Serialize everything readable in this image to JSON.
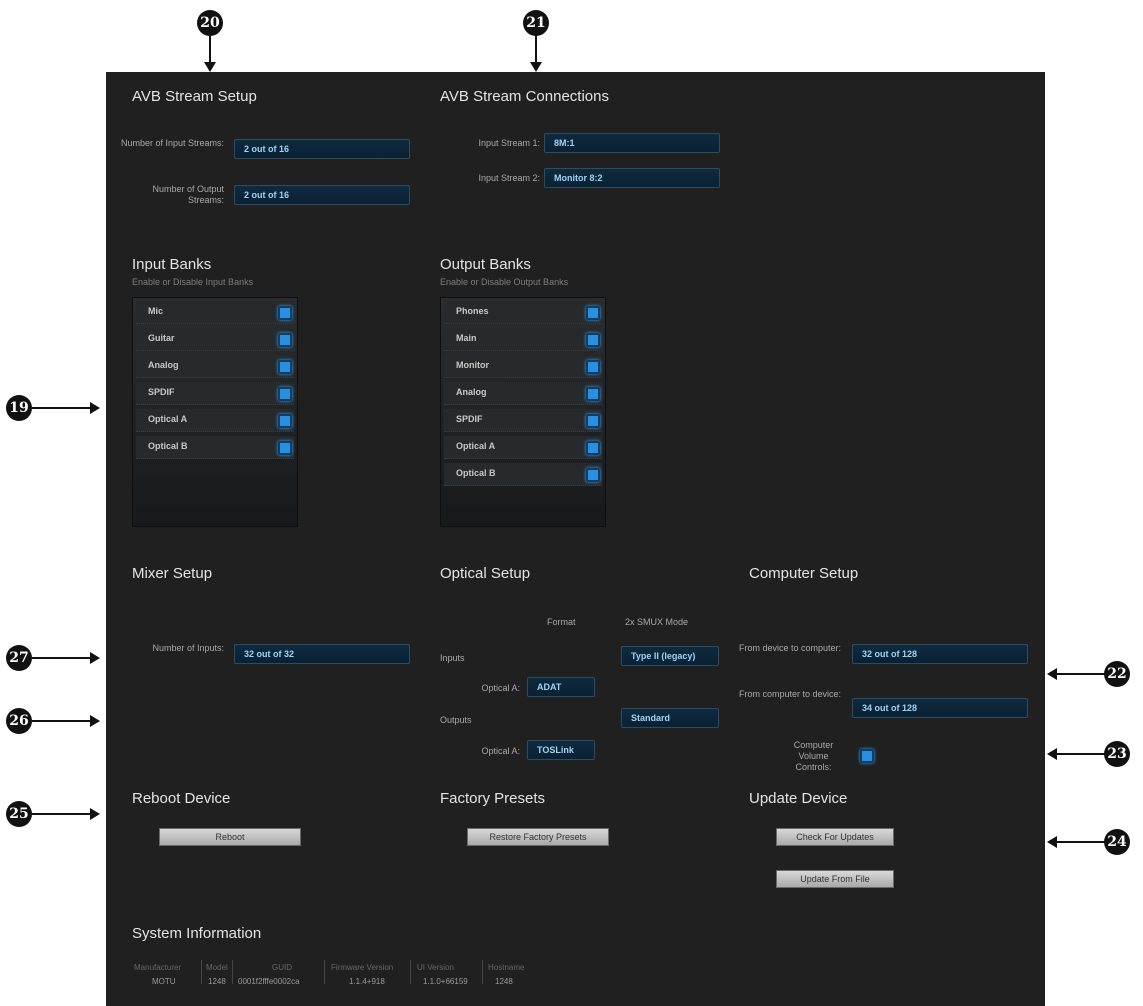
{
  "callouts": {
    "c19": "19",
    "c20": "20",
    "c21": "21",
    "c22": "22",
    "c23": "23",
    "c24": "24",
    "c25": "25",
    "c26": "26",
    "c27": "27"
  },
  "avb_setup": {
    "title": "AVB Stream Setup",
    "input_label": "Number of Input Streams:",
    "input_value": "2 out of 16",
    "output_label": "Number of Output Streams:",
    "output_value": "2 out of 16"
  },
  "avb_connections": {
    "title": "AVB Stream Connections",
    "stream1_label": "Input Stream 1:",
    "stream1_value": "8M:1",
    "stream2_label": "Input Stream 2:",
    "stream2_value": "Monitor 8:2"
  },
  "input_banks": {
    "title": "Input Banks",
    "subtitle": "Enable or Disable Input Banks",
    "items": [
      "Mic",
      "Guitar",
      "Analog",
      "SPDIF",
      "Optical A",
      "Optical B"
    ]
  },
  "output_banks": {
    "title": "Output Banks",
    "subtitle": "Enable or Disable Output Banks",
    "items": [
      "Phones",
      "Main",
      "Monitor",
      "Analog",
      "SPDIF",
      "Optical A",
      "Optical B"
    ]
  },
  "mixer_setup": {
    "title": "Mixer Setup",
    "inputs_label": "Number of Inputs:",
    "inputs_value": "32 out of 32"
  },
  "optical_setup": {
    "title": "Optical Setup",
    "format_header": "Format",
    "smux_header": "2x SMUX Mode",
    "inputs_label": "Inputs",
    "inputs_smux": "Type II (legacy)",
    "input_optical_label": "Optical A:",
    "input_optical_value": "ADAT",
    "outputs_label": "Outputs",
    "outputs_smux": "Standard",
    "output_optical_label": "Optical A:",
    "output_optical_value": "TOSLink"
  },
  "computer_setup": {
    "title": "Computer Setup",
    "d2c_label": "From device to computer:",
    "d2c_value": "32 out of 128",
    "c2d_label": "From computer to device:",
    "c2d_value": "34 out of 128",
    "volume_label": "Computer Volume Controls:"
  },
  "reboot": {
    "title": "Reboot Device",
    "button": "Reboot"
  },
  "factory": {
    "title": "Factory Presets",
    "button": "Restore Factory Presets"
  },
  "update": {
    "title": "Update Device",
    "check_button": "Check For Updates",
    "file_button": "Update From File"
  },
  "system_info": {
    "title": "System Information",
    "headers": [
      "Manufacturer",
      "Model",
      "GUID",
      "Firmware Version",
      "UI Version",
      "Hostname"
    ],
    "values": [
      "MOTU",
      "1248",
      "0001f2fffe0002ca",
      "1.1.4+918",
      "1.1.0+66159",
      "1248"
    ]
  },
  "colors": {
    "panel_bg": "#202020",
    "field_text": "#9dd3f7",
    "checkbox": "#2b8fe0"
  }
}
